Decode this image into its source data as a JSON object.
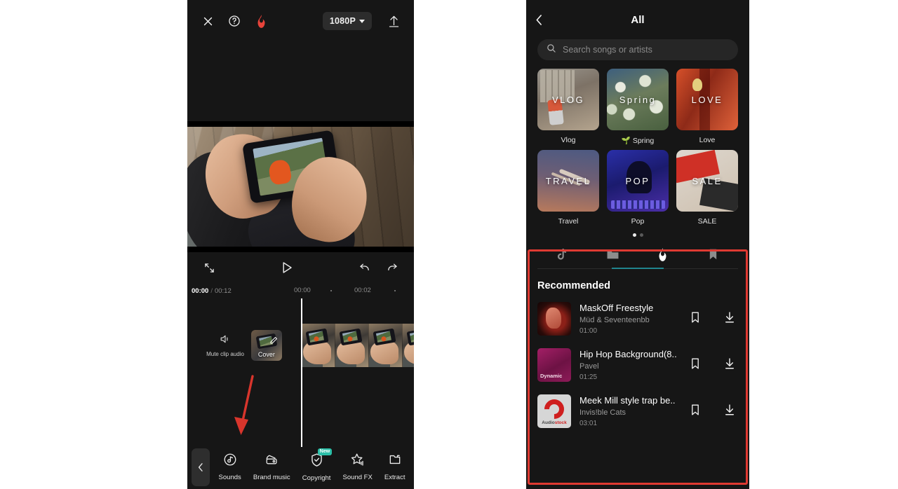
{
  "editor": {
    "topbar": {
      "close_icon": "close-icon",
      "help_icon": "help-icon",
      "flame_icon": "flame-icon",
      "resolution": "1080P",
      "upload_icon": "upload-icon"
    },
    "playback": {
      "fullscreen_icon": "fullscreen-icon",
      "play_icon": "play-icon",
      "undo_icon": "undo-icon",
      "redo_icon": "redo-icon"
    },
    "ruler": {
      "current_time": "00:00",
      "separator": "/",
      "total_time": "00:12",
      "ticks": [
        "00:00",
        "00:02"
      ]
    },
    "timeline": {
      "mute_label": "Mute clip audio",
      "mute_icon": "speaker-icon",
      "cover_label": "Cover",
      "cover_edit_icon": "pencil-icon",
      "add_label": "+"
    },
    "bottombar": {
      "back_icon": "chevron-left-icon",
      "items": [
        {
          "label": "Sounds",
          "icon": "music-note-icon",
          "badge": ""
        },
        {
          "label": "Brand music",
          "icon": "brand-music-icon",
          "badge": ""
        },
        {
          "label": "Copyright",
          "icon": "shield-check-icon",
          "badge": "New"
        },
        {
          "label": "Sound FX",
          "icon": "star-fx-icon",
          "badge": ""
        },
        {
          "label": "Extract",
          "icon": "extract-folder-icon",
          "badge": ""
        }
      ]
    }
  },
  "music_panel": {
    "header": {
      "back_icon": "chevron-left-icon",
      "title": "All"
    },
    "search": {
      "icon": "search-icon",
      "placeholder": "Search songs or artists"
    },
    "categories": [
      {
        "name": "Vlog",
        "card_title": "VLOG",
        "style": "bg-vlog"
      },
      {
        "name": "🌱 Spring",
        "card_title": "Spring",
        "style": "bg-spring"
      },
      {
        "name": "Love",
        "card_title": "LOVE",
        "style": "bg-love"
      },
      {
        "name": "Travel",
        "card_title": "TRAVEL",
        "style": "bg-travel"
      },
      {
        "name": "Pop",
        "card_title": "POP",
        "style": "bg-pop"
      },
      {
        "name": "SALE",
        "card_title": "SALE",
        "style": "bg-sale"
      }
    ],
    "pagination": {
      "count": 2,
      "active": 0
    },
    "tabs": [
      {
        "icon": "tiktok-note-icon",
        "active": false
      },
      {
        "icon": "folder-icon",
        "active": false
      },
      {
        "icon": "flame-icon",
        "active": true
      },
      {
        "icon": "bookmark-icon",
        "active": false
      }
    ],
    "section_title": "Recommended",
    "songs": [
      {
        "title": "MaskOff Freestyle",
        "artist": "Müd & Seventeenbb",
        "duration": "01:00",
        "art_label": "",
        "bookmark_icon": "bookmark-icon",
        "download_icon": "download-icon"
      },
      {
        "title": "Hip Hop Background(8..",
        "artist": "Pavel",
        "duration": "01:25",
        "art_label": "Dynamic",
        "bookmark_icon": "bookmark-icon",
        "download_icon": "download-icon"
      },
      {
        "title": "Meek Mill style trap be..",
        "artist": "Invis!ble Cats",
        "duration": "03:01",
        "art_label": "Audiostock",
        "bookmark_icon": "bookmark-icon",
        "download_icon": "download-icon"
      }
    ]
  },
  "annotations": {
    "arrow_color": "#d8352c",
    "highlight_color": "#df3a32"
  }
}
